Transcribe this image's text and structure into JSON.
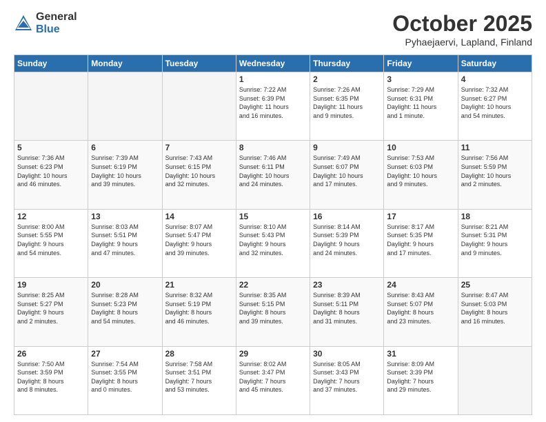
{
  "header": {
    "logo_general": "General",
    "logo_blue": "Blue",
    "month_title": "October 2025",
    "location": "Pyhaejaervi, Lapland, Finland"
  },
  "weekdays": [
    "Sunday",
    "Monday",
    "Tuesday",
    "Wednesday",
    "Thursday",
    "Friday",
    "Saturday"
  ],
  "weeks": [
    [
      {
        "day": "",
        "info": ""
      },
      {
        "day": "",
        "info": ""
      },
      {
        "day": "",
        "info": ""
      },
      {
        "day": "1",
        "info": "Sunrise: 7:22 AM\nSunset: 6:39 PM\nDaylight: 11 hours\nand 16 minutes."
      },
      {
        "day": "2",
        "info": "Sunrise: 7:26 AM\nSunset: 6:35 PM\nDaylight: 11 hours\nand 9 minutes."
      },
      {
        "day": "3",
        "info": "Sunrise: 7:29 AM\nSunset: 6:31 PM\nDaylight: 11 hours\nand 1 minute."
      },
      {
        "day": "4",
        "info": "Sunrise: 7:32 AM\nSunset: 6:27 PM\nDaylight: 10 hours\nand 54 minutes."
      }
    ],
    [
      {
        "day": "5",
        "info": "Sunrise: 7:36 AM\nSunset: 6:23 PM\nDaylight: 10 hours\nand 46 minutes."
      },
      {
        "day": "6",
        "info": "Sunrise: 7:39 AM\nSunset: 6:19 PM\nDaylight: 10 hours\nand 39 minutes."
      },
      {
        "day": "7",
        "info": "Sunrise: 7:43 AM\nSunset: 6:15 PM\nDaylight: 10 hours\nand 32 minutes."
      },
      {
        "day": "8",
        "info": "Sunrise: 7:46 AM\nSunset: 6:11 PM\nDaylight: 10 hours\nand 24 minutes."
      },
      {
        "day": "9",
        "info": "Sunrise: 7:49 AM\nSunset: 6:07 PM\nDaylight: 10 hours\nand 17 minutes."
      },
      {
        "day": "10",
        "info": "Sunrise: 7:53 AM\nSunset: 6:03 PM\nDaylight: 10 hours\nand 9 minutes."
      },
      {
        "day": "11",
        "info": "Sunrise: 7:56 AM\nSunset: 5:59 PM\nDaylight: 10 hours\nand 2 minutes."
      }
    ],
    [
      {
        "day": "12",
        "info": "Sunrise: 8:00 AM\nSunset: 5:55 PM\nDaylight: 9 hours\nand 54 minutes."
      },
      {
        "day": "13",
        "info": "Sunrise: 8:03 AM\nSunset: 5:51 PM\nDaylight: 9 hours\nand 47 minutes."
      },
      {
        "day": "14",
        "info": "Sunrise: 8:07 AM\nSunset: 5:47 PM\nDaylight: 9 hours\nand 39 minutes."
      },
      {
        "day": "15",
        "info": "Sunrise: 8:10 AM\nSunset: 5:43 PM\nDaylight: 9 hours\nand 32 minutes."
      },
      {
        "day": "16",
        "info": "Sunrise: 8:14 AM\nSunset: 5:39 PM\nDaylight: 9 hours\nand 24 minutes."
      },
      {
        "day": "17",
        "info": "Sunrise: 8:17 AM\nSunset: 5:35 PM\nDaylight: 9 hours\nand 17 minutes."
      },
      {
        "day": "18",
        "info": "Sunrise: 8:21 AM\nSunset: 5:31 PM\nDaylight: 9 hours\nand 9 minutes."
      }
    ],
    [
      {
        "day": "19",
        "info": "Sunrise: 8:25 AM\nSunset: 5:27 PM\nDaylight: 9 hours\nand 2 minutes."
      },
      {
        "day": "20",
        "info": "Sunrise: 8:28 AM\nSunset: 5:23 PM\nDaylight: 8 hours\nand 54 minutes."
      },
      {
        "day": "21",
        "info": "Sunrise: 8:32 AM\nSunset: 5:19 PM\nDaylight: 8 hours\nand 46 minutes."
      },
      {
        "day": "22",
        "info": "Sunrise: 8:35 AM\nSunset: 5:15 PM\nDaylight: 8 hours\nand 39 minutes."
      },
      {
        "day": "23",
        "info": "Sunrise: 8:39 AM\nSunset: 5:11 PM\nDaylight: 8 hours\nand 31 minutes."
      },
      {
        "day": "24",
        "info": "Sunrise: 8:43 AM\nSunset: 5:07 PM\nDaylight: 8 hours\nand 23 minutes."
      },
      {
        "day": "25",
        "info": "Sunrise: 8:47 AM\nSunset: 5:03 PM\nDaylight: 8 hours\nand 16 minutes."
      }
    ],
    [
      {
        "day": "26",
        "info": "Sunrise: 7:50 AM\nSunset: 3:59 PM\nDaylight: 8 hours\nand 8 minutes."
      },
      {
        "day": "27",
        "info": "Sunrise: 7:54 AM\nSunset: 3:55 PM\nDaylight: 8 hours\nand 0 minutes."
      },
      {
        "day": "28",
        "info": "Sunrise: 7:58 AM\nSunset: 3:51 PM\nDaylight: 7 hours\nand 53 minutes."
      },
      {
        "day": "29",
        "info": "Sunrise: 8:02 AM\nSunset: 3:47 PM\nDaylight: 7 hours\nand 45 minutes."
      },
      {
        "day": "30",
        "info": "Sunrise: 8:05 AM\nSunset: 3:43 PM\nDaylight: 7 hours\nand 37 minutes."
      },
      {
        "day": "31",
        "info": "Sunrise: 8:09 AM\nSunset: 3:39 PM\nDaylight: 7 hours\nand 29 minutes."
      },
      {
        "day": "",
        "info": ""
      }
    ]
  ]
}
